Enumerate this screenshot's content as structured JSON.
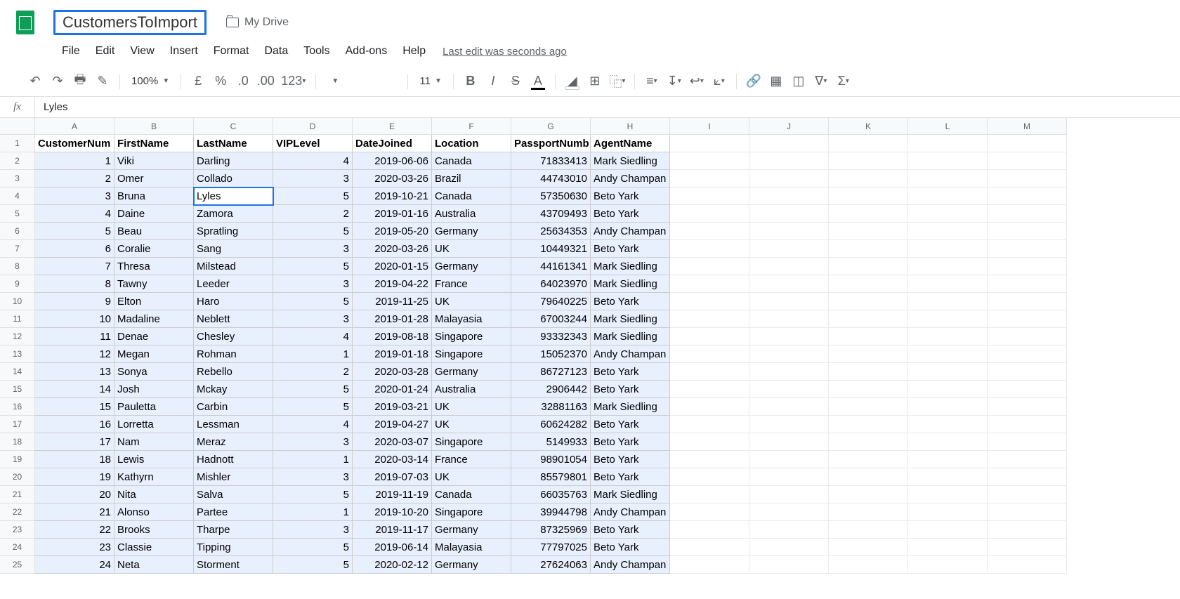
{
  "doc_title": "CustomersToImport",
  "folder_label": "My Drive",
  "menus": [
    "File",
    "Edit",
    "View",
    "Insert",
    "Format",
    "Data",
    "Tools",
    "Add-ons",
    "Help"
  ],
  "last_edit": "Last edit was seconds ago",
  "zoom": "100%",
  "currency_symbol": "£",
  "font_size": "11",
  "formula_value": "Lyles",
  "columns": [
    "A",
    "B",
    "C",
    "D",
    "E",
    "F",
    "G",
    "H",
    "I",
    "J",
    "K",
    "L",
    "M"
  ],
  "header_row": [
    "CustomerNum",
    "FirstName",
    "LastName",
    "VIPLevel",
    "DateJoined",
    "Location",
    "PassportNumb",
    "AgentName"
  ],
  "numeric_cols": [
    0,
    3,
    6
  ],
  "date_cols": [
    4
  ],
  "active_cell": {
    "row": 3,
    "col": 2
  },
  "data_rows": [
    [
      "1",
      "Viki",
      "Darling",
      "4",
      "2019-06-06",
      "Canada",
      "71833413",
      "Mark Siedling"
    ],
    [
      "2",
      "Omer",
      "Collado",
      "3",
      "2020-03-26",
      "Brazil",
      "44743010",
      "Andy Champan"
    ],
    [
      "3",
      "Bruna",
      "Lyles",
      "5",
      "2019-10-21",
      "Canada",
      "57350630",
      "Beto Yark"
    ],
    [
      "4",
      "Daine",
      "Zamora",
      "2",
      "2019-01-16",
      "Australia",
      "43709493",
      "Beto Yark"
    ],
    [
      "5",
      "Beau",
      "Spratling",
      "5",
      "2019-05-20",
      "Germany",
      "25634353",
      "Andy Champan"
    ],
    [
      "6",
      "Coralie",
      "Sang",
      "3",
      "2020-03-26",
      "UK",
      "10449321",
      "Beto Yark"
    ],
    [
      "7",
      "Thresa",
      "Milstead",
      "5",
      "2020-01-15",
      "Germany",
      "44161341",
      "Mark Siedling"
    ],
    [
      "8",
      "Tawny",
      "Leeder",
      "3",
      "2019-04-22",
      "France",
      "64023970",
      "Mark Siedling"
    ],
    [
      "9",
      "Elton",
      "Haro",
      "5",
      "2019-11-25",
      "UK",
      "79640225",
      "Beto Yark"
    ],
    [
      "10",
      "Madaline",
      "Neblett",
      "3",
      "2019-01-28",
      "Malayasia",
      "67003244",
      "Mark Siedling"
    ],
    [
      "11",
      "Denae",
      "Chesley",
      "4",
      "2019-08-18",
      "Singapore",
      "93332343",
      "Mark Siedling"
    ],
    [
      "12",
      "Megan",
      "Rohman",
      "1",
      "2019-01-18",
      "Singapore",
      "15052370",
      "Andy Champan"
    ],
    [
      "13",
      "Sonya",
      "Rebello",
      "2",
      "2020-03-28",
      "Germany",
      "86727123",
      "Beto Yark"
    ],
    [
      "14",
      "Josh",
      "Mckay",
      "5",
      "2020-01-24",
      "Australia",
      "2906442",
      "Beto Yark"
    ],
    [
      "15",
      "Pauletta",
      "Carbin",
      "5",
      "2019-03-21",
      "UK",
      "32881163",
      "Mark Siedling"
    ],
    [
      "16",
      "Lorretta",
      "Lessman",
      "4",
      "2019-04-27",
      "UK",
      "60624282",
      "Beto Yark"
    ],
    [
      "17",
      "Nam",
      "Meraz",
      "3",
      "2020-03-07",
      "Singapore",
      "5149933",
      "Beto Yark"
    ],
    [
      "18",
      "Lewis",
      "Hadnott",
      "1",
      "2020-03-14",
      "France",
      "98901054",
      "Beto Yark"
    ],
    [
      "19",
      "Kathyrn",
      "Mishler",
      "3",
      "2019-07-03",
      "UK",
      "85579801",
      "Beto Yark"
    ],
    [
      "20",
      "Nita",
      "Salva",
      "5",
      "2019-11-19",
      "Canada",
      "66035763",
      "Mark Siedling"
    ],
    [
      "21",
      "Alonso",
      "Partee",
      "1",
      "2019-10-20",
      "Singapore",
      "39944798",
      "Andy Champan"
    ],
    [
      "22",
      "Brooks",
      "Tharpe",
      "3",
      "2019-11-17",
      "Germany",
      "87325969",
      "Beto Yark"
    ],
    [
      "23",
      "Classie",
      "Tipping",
      "5",
      "2019-06-14",
      "Malayasia",
      "77797025",
      "Beto Yark"
    ],
    [
      "24",
      "Neta",
      "Storment",
      "5",
      "2020-02-12",
      "Germany",
      "27624063",
      "Andy Champan"
    ]
  ]
}
